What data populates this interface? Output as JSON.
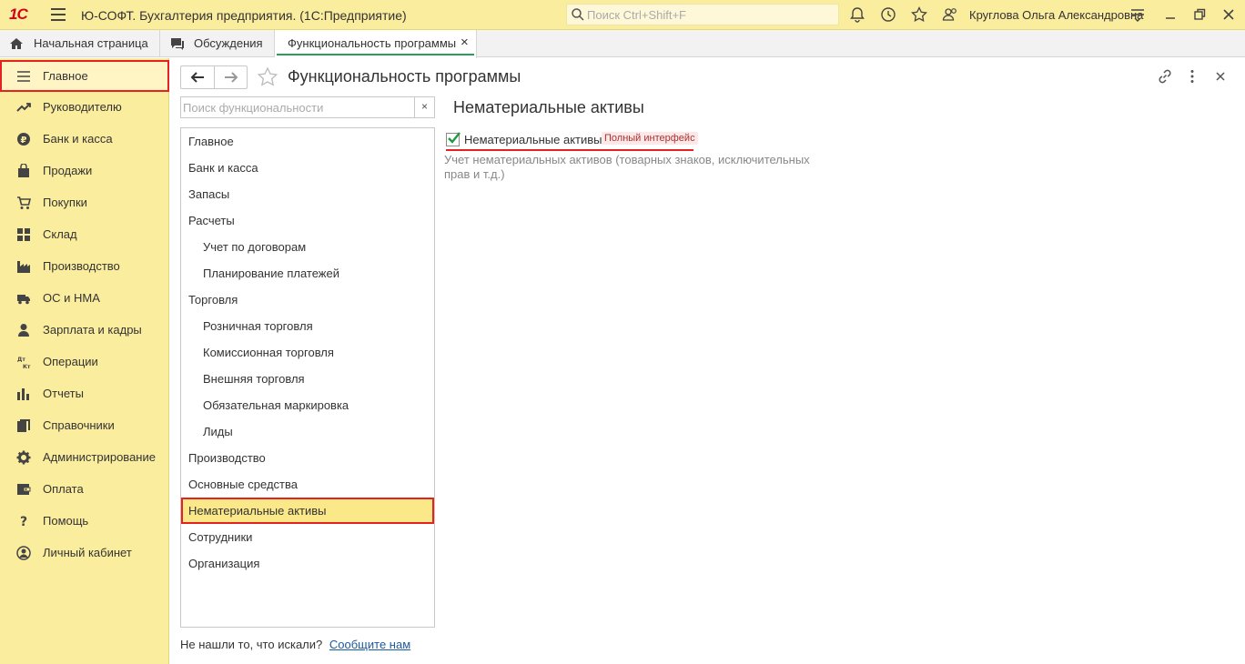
{
  "titlebar": {
    "logo": "1С",
    "app_title": "Ю-СОФТ. Бухгалтерия предприятия.  (1С:Предприятие)",
    "search_placeholder": "Поиск Ctrl+Shift+F",
    "user_name": "Круглова Ольга Александровна"
  },
  "tabs": [
    {
      "label": "Начальная страница",
      "icon": "home-icon"
    },
    {
      "label": "Обсуждения",
      "icon": "discussions-icon"
    },
    {
      "label": "Функциональность программы",
      "close": "×",
      "active": true
    }
  ],
  "sidebar": {
    "items": [
      {
        "label": "Главное",
        "icon": "menu-lines-icon",
        "selected": true
      },
      {
        "label": "Руководителю",
        "icon": "trend-icon"
      },
      {
        "label": "Банк и касса",
        "icon": "ruble-coin-icon"
      },
      {
        "label": "Продажи",
        "icon": "shopping-bag-icon"
      },
      {
        "label": "Покупки",
        "icon": "cart-icon"
      },
      {
        "label": "Склад",
        "icon": "warehouse-icon"
      },
      {
        "label": "Производство",
        "icon": "factory-icon"
      },
      {
        "label": "ОС и НМА",
        "icon": "truck-icon"
      },
      {
        "label": "Зарплата и кадры",
        "icon": "person-icon"
      },
      {
        "label": "Операции",
        "icon": "debit-credit-icon"
      },
      {
        "label": "Отчеты",
        "icon": "bar-chart-icon"
      },
      {
        "label": "Справочники",
        "icon": "books-icon"
      },
      {
        "label": "Администрирование",
        "icon": "gear-icon"
      },
      {
        "label": "Оплата",
        "icon": "wallet-icon"
      },
      {
        "label": "Помощь",
        "icon": "question-icon"
      },
      {
        "label": "Личный кабинет",
        "icon": "account-icon"
      }
    ]
  },
  "main": {
    "title": "Функциональность программы",
    "search_placeholder": "Поиск функциональности",
    "clear": "×",
    "tree": [
      {
        "label": "Главное",
        "level": 0
      },
      {
        "label": "Банк и касса",
        "level": 0
      },
      {
        "label": "Запасы",
        "level": 0
      },
      {
        "label": "Расчеты",
        "level": 0
      },
      {
        "label": "Учет по договорам",
        "level": 1
      },
      {
        "label": "Планирование платежей",
        "level": 1
      },
      {
        "label": "Торговля",
        "level": 0
      },
      {
        "label": "Розничная торговля",
        "level": 1
      },
      {
        "label": "Комиссионная торговля",
        "level": 1
      },
      {
        "label": "Внешняя торговля",
        "level": 1
      },
      {
        "label": "Обязательная маркировка",
        "level": 1
      },
      {
        "label": "Лиды",
        "level": 1
      },
      {
        "label": "Производство",
        "level": 0
      },
      {
        "label": "Основные средства",
        "level": 0
      },
      {
        "label": "Нематериальные активы",
        "level": 0,
        "selected": true
      },
      {
        "label": "Сотрудники",
        "level": 0
      },
      {
        "label": "Организация",
        "level": 0
      }
    ],
    "not_found_text": "Не нашли то, что искали?",
    "report_link": "Сообщите нам"
  },
  "section": {
    "title": "Нематериальные активы",
    "checkbox_label": "Нематериальные активы",
    "checkbox_checked": true,
    "badge": "Полный интерфейс",
    "description": "Учет нематериальных активов (товарных знаков, исключительных прав и т.д.)"
  },
  "colors": {
    "accent_yellow": "#fbed9e",
    "highlight_red": "#e52222",
    "active_tab_underline": "#2b9c56",
    "link": "#1a5a9f"
  }
}
